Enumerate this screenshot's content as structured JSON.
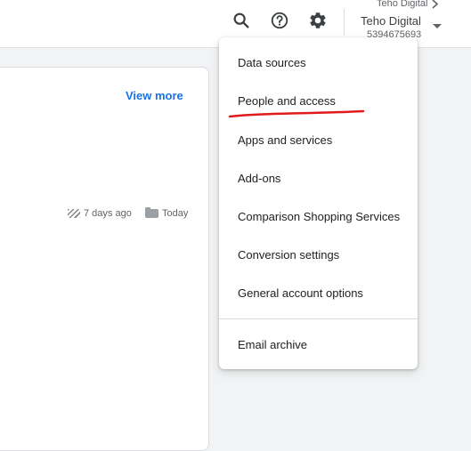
{
  "header": {
    "search_icon": "search-icon",
    "help_icon": "help-icon",
    "settings_icon": "gear-icon",
    "account": {
      "breadcrumb": "Teho Digital",
      "name": "Teho Digital",
      "id": "5394675693"
    }
  },
  "card": {
    "view_more": "View more",
    "meta_left": "7 days ago",
    "meta_right": "Today"
  },
  "menu": {
    "items": [
      {
        "label": "Data sources"
      },
      {
        "label": "People and access"
      },
      {
        "label": "Apps and services"
      },
      {
        "label": "Add-ons"
      },
      {
        "label": "Comparison Shopping Services"
      },
      {
        "label": "Conversion settings"
      },
      {
        "label": "General account options"
      },
      {
        "label": "Email archive"
      }
    ]
  },
  "colors": {
    "accent": "#1a73e8",
    "annotation": "#e01b1b"
  }
}
